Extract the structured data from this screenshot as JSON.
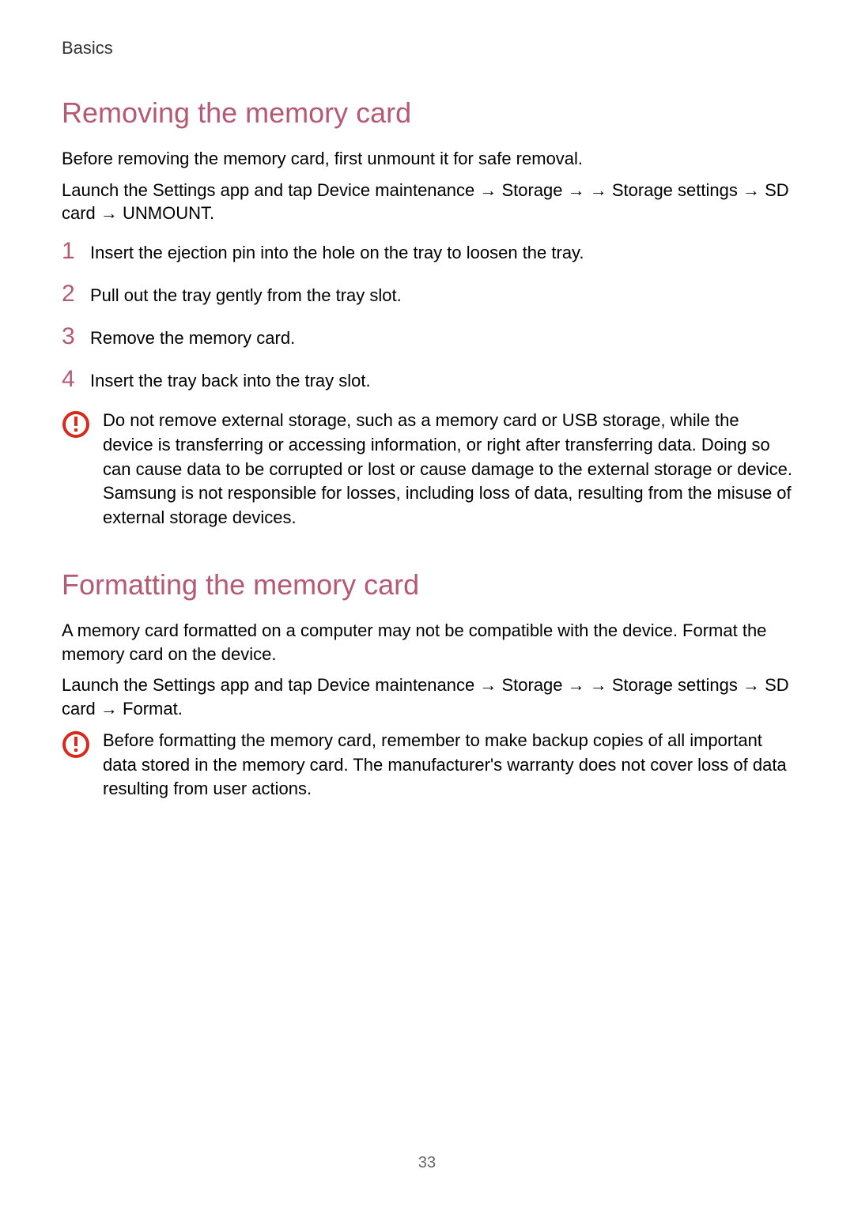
{
  "header": {
    "category": "Basics"
  },
  "section1": {
    "heading": "Removing the memory card",
    "intro": "Before removing the memory card, first unmount it for safe removal.",
    "nav": "Launch the Settings app and tap Device maintenance → Storage → → Storage settings → SD card → UNMOUNT.",
    "steps": [
      "Insert the ejection pin into the hole on the tray to loosen the tray.",
      "Pull out the tray gently from the tray slot.",
      "Remove the memory card.",
      "Insert the tray back into the tray slot."
    ],
    "warning": "Do not remove external storage, such as a memory card or USB storage, while the device is transferring or accessing information, or right after transferring data. Doing so can cause data to be corrupted or lost or cause damage to the external storage or device. Samsung is not responsible for losses, including loss of data, resulting from the misuse of external storage devices."
  },
  "section2": {
    "heading": "Formatting the memory card",
    "intro": "A memory card formatted on a computer may not be compatible with the device. Format the memory card on the device.",
    "nav": "Launch the Settings app and tap Device maintenance → Storage → → Storage settings → SD card → Format.",
    "warning": "Before formatting the memory card, remember to make backup copies of all important data stored in the memory card. The manufacturer's warranty does not cover loss of data resulting from user actions."
  },
  "page": {
    "number": "33"
  },
  "step_numbers": [
    "1",
    "2",
    "3",
    "4"
  ]
}
